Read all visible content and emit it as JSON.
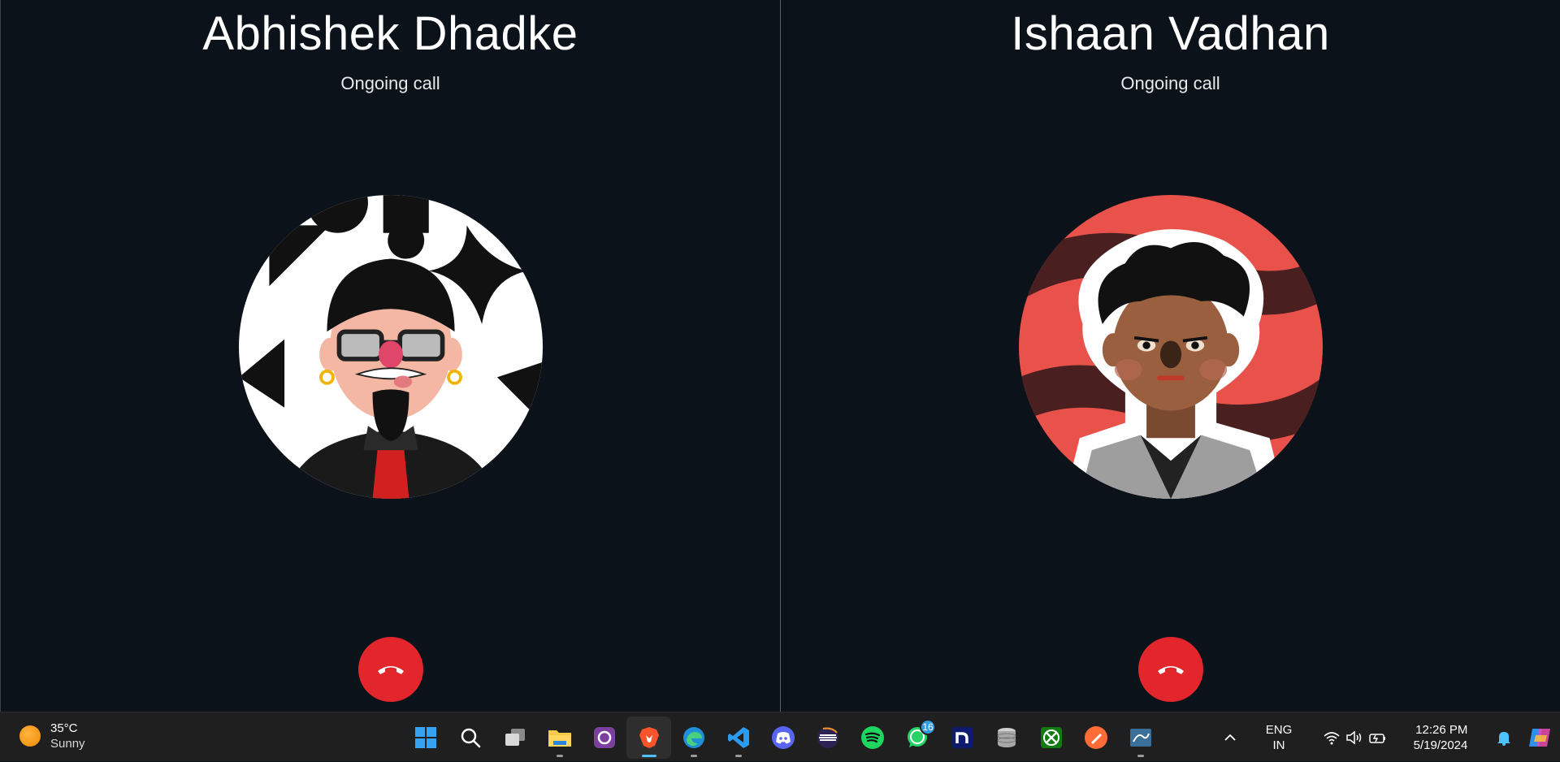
{
  "calls": [
    {
      "caller_name": "Abhishek Dhadke",
      "status": "Ongoing call",
      "hangup_icon": "phone-hangup-icon"
    },
    {
      "caller_name": "Ishaan Vadhan",
      "status": "Ongoing call",
      "hangup_icon": "phone-hangup-icon"
    }
  ],
  "taskbar": {
    "weather": {
      "temperature": "35°C",
      "condition": "Sunny",
      "icon": "sun-icon"
    },
    "apps": [
      {
        "name": "start",
        "icon": "windows-logo-icon"
      },
      {
        "name": "search",
        "icon": "search-icon"
      },
      {
        "name": "task-view",
        "icon": "task-view-icon"
      },
      {
        "name": "file-explorer",
        "icon": "folder-icon"
      },
      {
        "name": "app-store",
        "icon": "app-store-icon"
      },
      {
        "name": "brave",
        "icon": "brave-browser-icon"
      },
      {
        "name": "edge",
        "icon": "edge-browser-icon"
      },
      {
        "name": "vscode",
        "icon": "vscode-icon"
      },
      {
        "name": "discord",
        "icon": "discord-icon"
      },
      {
        "name": "eclipse",
        "icon": "eclipse-icon"
      },
      {
        "name": "spotify",
        "icon": "spotify-icon"
      },
      {
        "name": "whatsapp",
        "icon": "whatsapp-icon",
        "badge": "16"
      },
      {
        "name": "notion-like",
        "icon": "n-app-icon"
      },
      {
        "name": "database",
        "icon": "database-icon"
      },
      {
        "name": "xbox",
        "icon": "xbox-icon"
      },
      {
        "name": "postman",
        "icon": "postman-icon"
      },
      {
        "name": "mysql-workbench",
        "icon": "mysql-workbench-icon"
      }
    ],
    "tray": {
      "language_line1": "ENG",
      "language_line2": "IN",
      "time": "12:26 PM",
      "date": "5/19/2024"
    }
  },
  "colors": {
    "background": "#0b121a",
    "hangup": "#e3262b",
    "taskbar": "#1f1f1f",
    "accent": "#4cc2ff"
  }
}
